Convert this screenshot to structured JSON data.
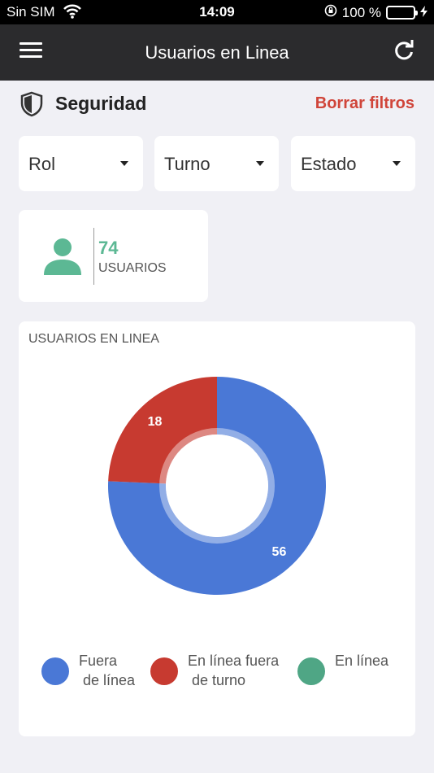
{
  "status_bar": {
    "carrier": "Sin SIM",
    "time": "14:09",
    "battery": "100 %"
  },
  "nav": {
    "title": "Usuarios en Linea"
  },
  "section": {
    "label": "Seguridad",
    "clear_filters": "Borrar filtros"
  },
  "filters": [
    {
      "label": "Rol"
    },
    {
      "label": "Turno"
    },
    {
      "label": "Estado"
    }
  ],
  "users": {
    "count": "74",
    "label": "USUARIOS"
  },
  "colors": {
    "offline": "#4a78d6",
    "online_off_shift": "#c73a30",
    "online": "#4fa685",
    "accent_red": "#d0453a",
    "users_green": "#5cb894"
  },
  "chart_data": {
    "type": "pie",
    "title": "USUARIOS EN LINEA",
    "categories": [
      "Fuera\n de línea",
      "En línea fuera\n de turno",
      "En línea"
    ],
    "values": [
      56,
      18,
      0
    ],
    "data_labels": [
      "56",
      "18",
      ""
    ],
    "legend_position": "bottom"
  }
}
